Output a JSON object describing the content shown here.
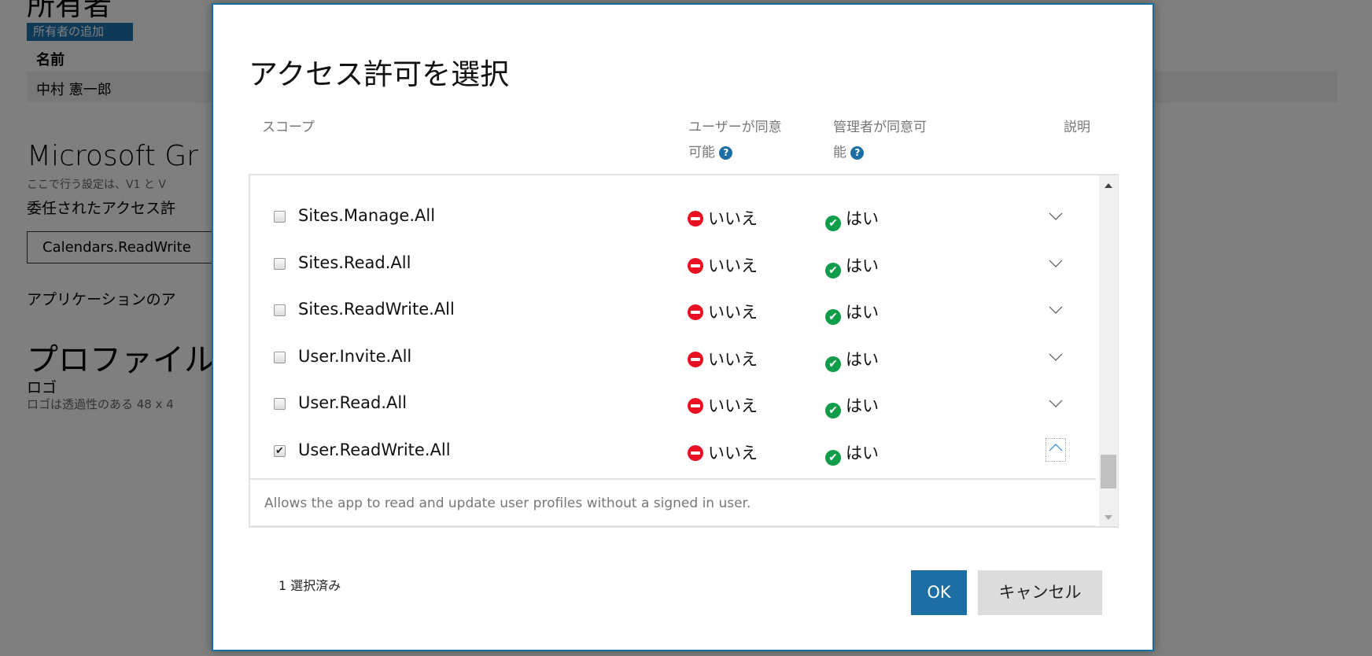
{
  "background": {
    "owners_heading": "所有者",
    "add_owner_button": "所有者の追加",
    "name_column": "名前",
    "owner_name": "中村 憲一郎",
    "graph_heading": "Microsoft Gr",
    "graph_note": "ここで行う設定は、V1 と V",
    "delegated_label": "委任されたアクセス許",
    "delegated_value": "Calendars.ReadWrite",
    "application_label": "アプリケーションのア",
    "profile_heading": "プロファイル",
    "logo_label": "ロゴ",
    "logo_note": "ロゴは透過性のある 48 x 4"
  },
  "dialog": {
    "title": "アクセス許可を選択",
    "columns": {
      "scope": "スコープ",
      "user_consent": "ユーザーが同意可能",
      "user_consent_l1": "ユーザーが同意",
      "user_consent_l2": "可能",
      "admin_consent_l1": "管理者が同意可",
      "admin_consent_l2": "能",
      "description": "説明"
    },
    "rows": [
      {
        "scope": "Sites.Manage.All",
        "user": "いいえ",
        "admin": "はい",
        "checked": false
      },
      {
        "scope": "Sites.Read.All",
        "user": "いいえ",
        "admin": "はい",
        "checked": false
      },
      {
        "scope": "Sites.ReadWrite.All",
        "user": "いいえ",
        "admin": "はい",
        "checked": false
      },
      {
        "scope": "User.Invite.All",
        "user": "いいえ",
        "admin": "はい",
        "checked": false
      },
      {
        "scope": "User.Read.All",
        "user": "いいえ",
        "admin": "はい",
        "checked": false
      },
      {
        "scope": "User.ReadWrite.All",
        "user": "いいえ",
        "admin": "はい",
        "checked": true
      }
    ],
    "expanded_description": "Allows the app to read and update user profiles without a signed in user.",
    "selected_count": "1 選択済み",
    "ok_label": "OK",
    "cancel_label": "キャンセル",
    "checkmark": "✔",
    "help_glyph": "?"
  },
  "colors": {
    "accent": "#1e6ea6",
    "no": "#e81123",
    "yes": "#0f9d4a"
  }
}
